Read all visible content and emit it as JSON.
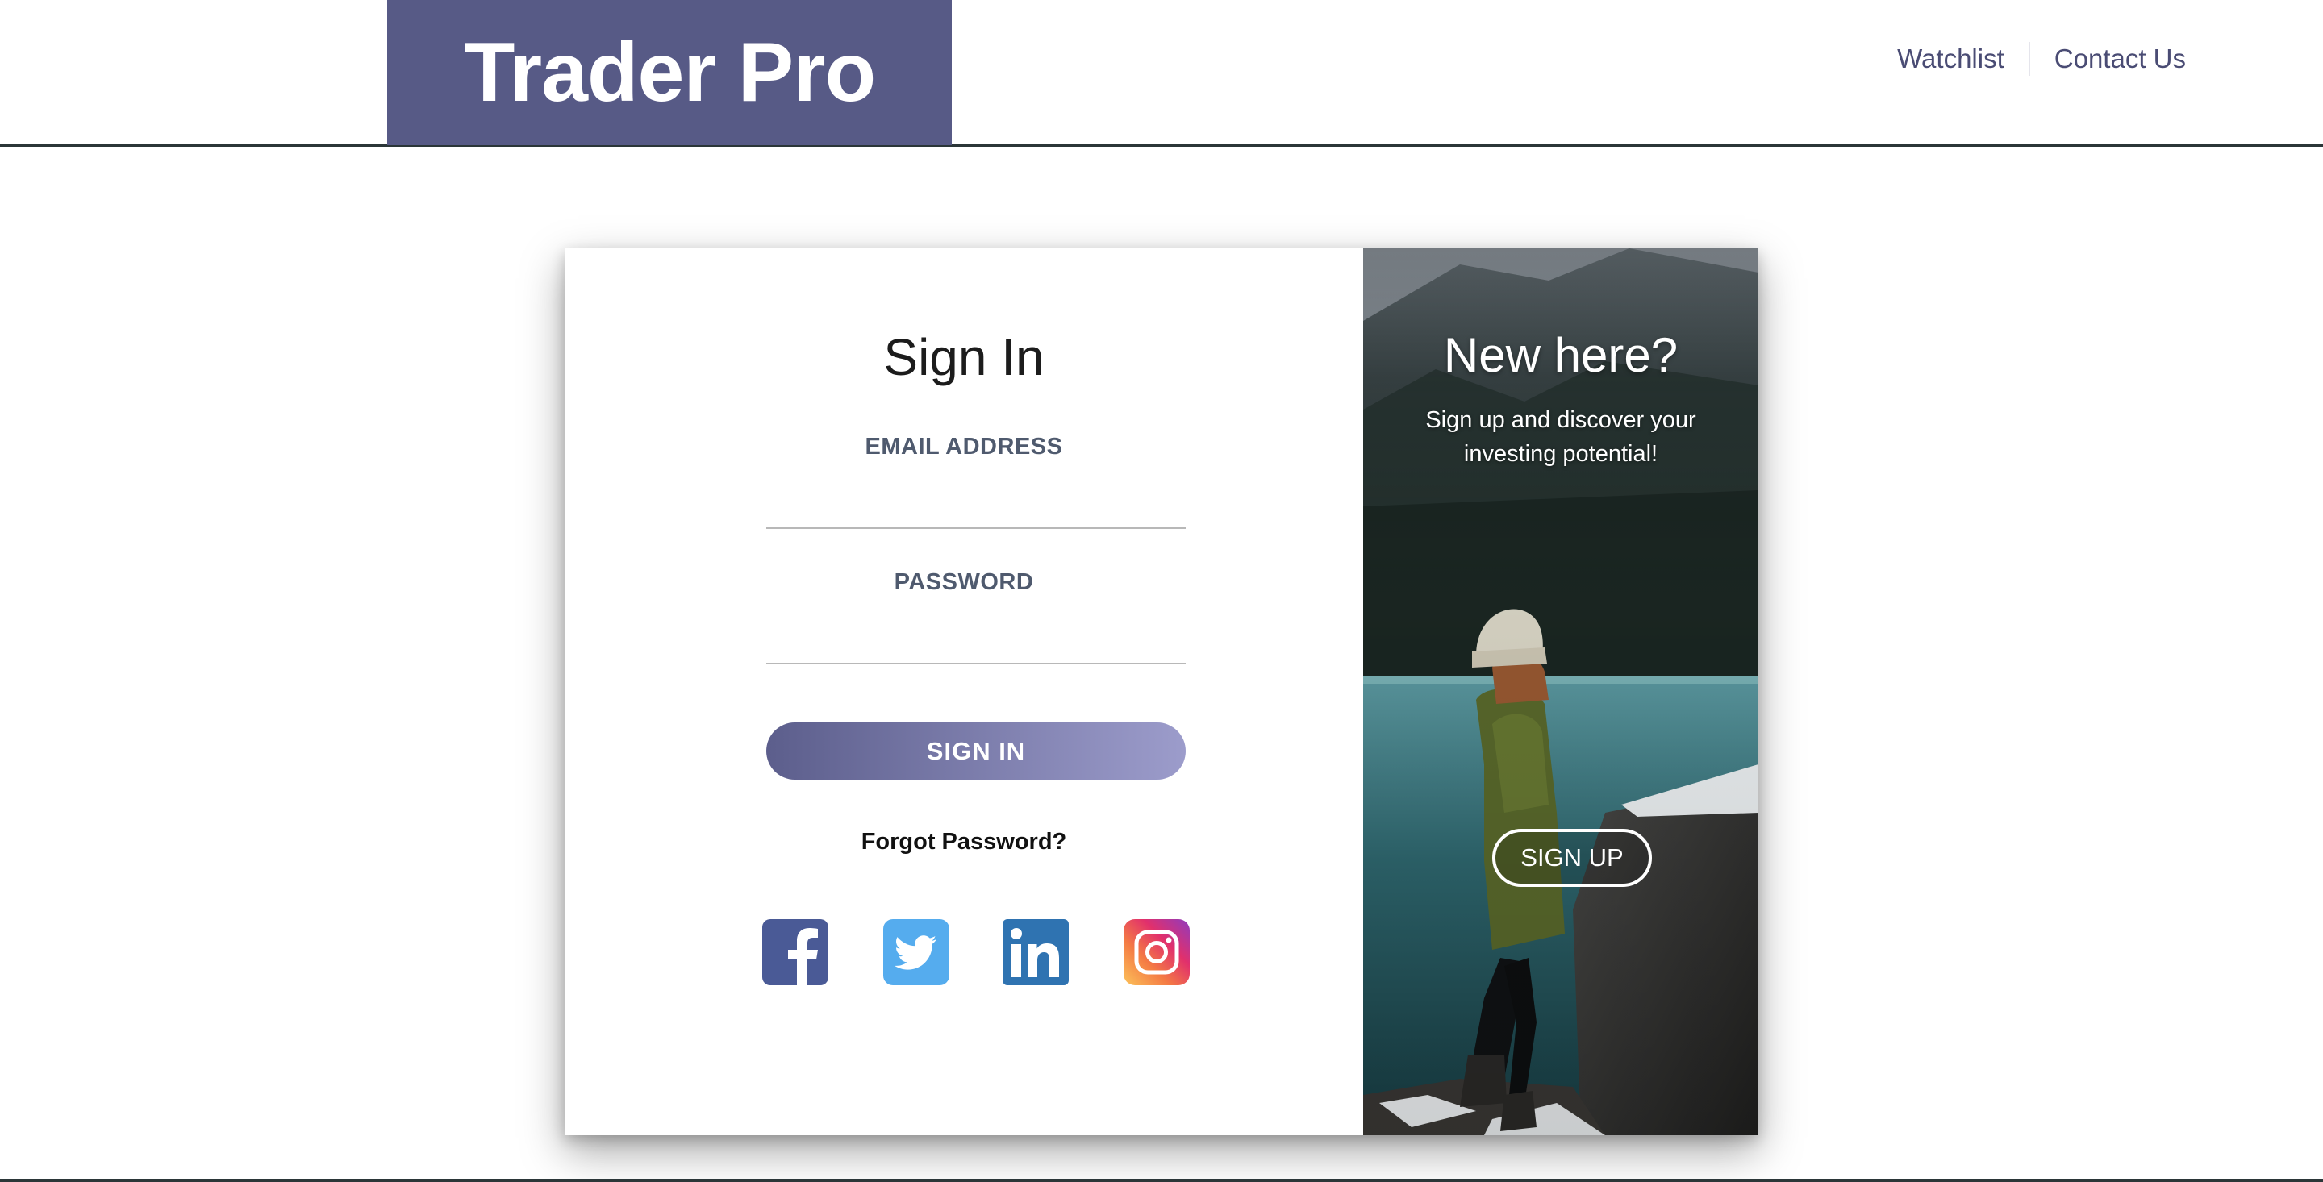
{
  "header": {
    "logo": "Trader Pro",
    "nav": [
      {
        "label": "Watchlist"
      },
      {
        "label": "Contact Us"
      }
    ]
  },
  "signin": {
    "title": "Sign In",
    "email_label": "EMAIL ADDRESS",
    "email_value": "",
    "password_label": "PASSWORD",
    "password_value": "",
    "button": "SIGN IN",
    "forgot": "Forgot Password?",
    "socials": [
      "facebook-icon",
      "twitter-icon",
      "linkedin-icon",
      "instagram-icon"
    ]
  },
  "signup": {
    "title": "New here?",
    "subtitle": "Sign up and discover your investing potential!",
    "button": "SIGN UP"
  },
  "colors": {
    "brand": "#575a86",
    "nav_text": "#4a4c74",
    "label": "#4f5a6e",
    "facebook": "#3b5998",
    "twitter": "#55acee",
    "linkedin": "#2f73b1"
  }
}
